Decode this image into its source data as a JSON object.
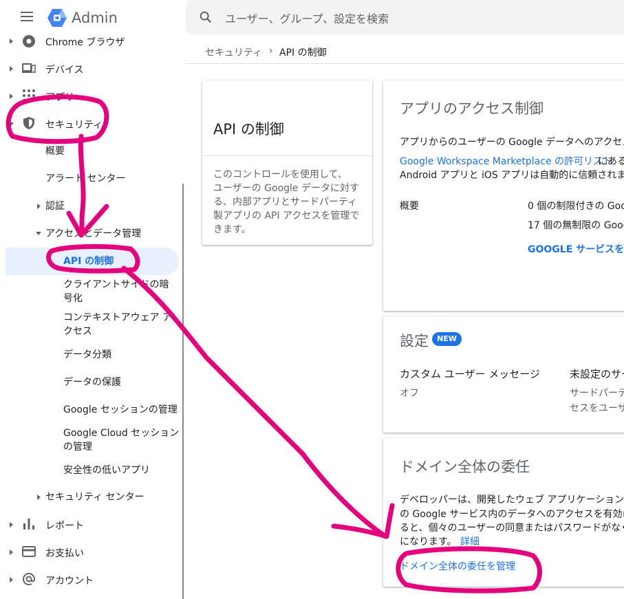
{
  "app": {
    "brand": "Admin",
    "menu_icon": "hamburger-menu-icon",
    "logo_icon": "admin-hexagon-logo-icon"
  },
  "search": {
    "placeholder": "ユーザー、グループ、設定を検索",
    "icon": "search-icon"
  },
  "breadcrumb": {
    "parent": "セキュリティ",
    "separator": "›",
    "current": "API の制御"
  },
  "sidebar": {
    "items": [
      {
        "label": "Chrome ブラウザ",
        "icon": "chrome-icon"
      },
      {
        "label": "デバイス",
        "icon": "devices-icon"
      },
      {
        "label": "アプリ",
        "icon": "apps-grid-icon"
      },
      {
        "label": "セキュリティ",
        "icon": "shield-icon"
      },
      {
        "label": "レポート",
        "icon": "bar-chart-icon"
      },
      {
        "label": "お支払い",
        "icon": "credit-card-icon"
      },
      {
        "label": "アカウント",
        "icon": "at-sign-icon"
      }
    ],
    "security_sub": {
      "overview": "概要",
      "alert_center": "アラート センター",
      "auth": "認証",
      "access_data": "アクセスとデータ管理",
      "security_center": "セキュリティ センター"
    },
    "access_sub": {
      "api_control": "API の制御",
      "client_side_1": "クライアントサイドの暗",
      "client_side_2": "号化",
      "context_1": "コンテキストアウェア ア",
      "context_2": "クセス",
      "data_class": "データ分類",
      "data_protect": "データの保護",
      "google_session": "Google セッションの管理",
      "cloud_session_1": "Google Cloud セッション",
      "cloud_session_2": "の管理",
      "less_secure": "安全性の低いアプリ"
    }
  },
  "left_card": {
    "title": "API の制御",
    "desc": [
      "このコントロールを使用して、",
      "ユーザーの Google データに対す",
      "る、内部アプリとサードパーティ",
      "製アプリの API アクセスを管理で",
      "きます。"
    ]
  },
  "access_card": {
    "title": "アプリのアクセス制御",
    "line1": "アプリからのユーザーの Google データへのアクセス",
    "line2_link": "Google Workspace Marketplace の許可リスト",
    "line2_rest": "にある",
    "line3": "Android アプリと iOS アプリは自動的に信頼されます",
    "overview_label": "概要",
    "restricted": "0 個の制限付きの Goog",
    "unrestricted": "17 個の無制限の Goog",
    "manage_link": "GOOGLE サービスを管"
  },
  "settings_card": {
    "title": "設定",
    "badge": "NEW",
    "custom_msg_label": "カスタム ユーザー メッセージ",
    "custom_msg_value": "オフ",
    "unset_label": "未設定のサー",
    "unset_desc_1": "サードパーテ",
    "unset_desc_2": "セスをユーザ"
  },
  "delegation_card": {
    "title": "ドメイン全体の委任",
    "p1": "デベロッパーは、開発したウェブ アプリケーション",
    "p2": "の Google サービス内のデータへのアクセスを有効に",
    "p3": "ると、個々のユーザーの同意またはパスワードがなく",
    "p4": "になります。",
    "learn_more": "詳細",
    "manage_link": "ドメイン全体の委任を管理"
  },
  "colors": {
    "accent": "#1a73e8",
    "annotation": "#e6007e",
    "active_bg": "#e8f0fe"
  }
}
